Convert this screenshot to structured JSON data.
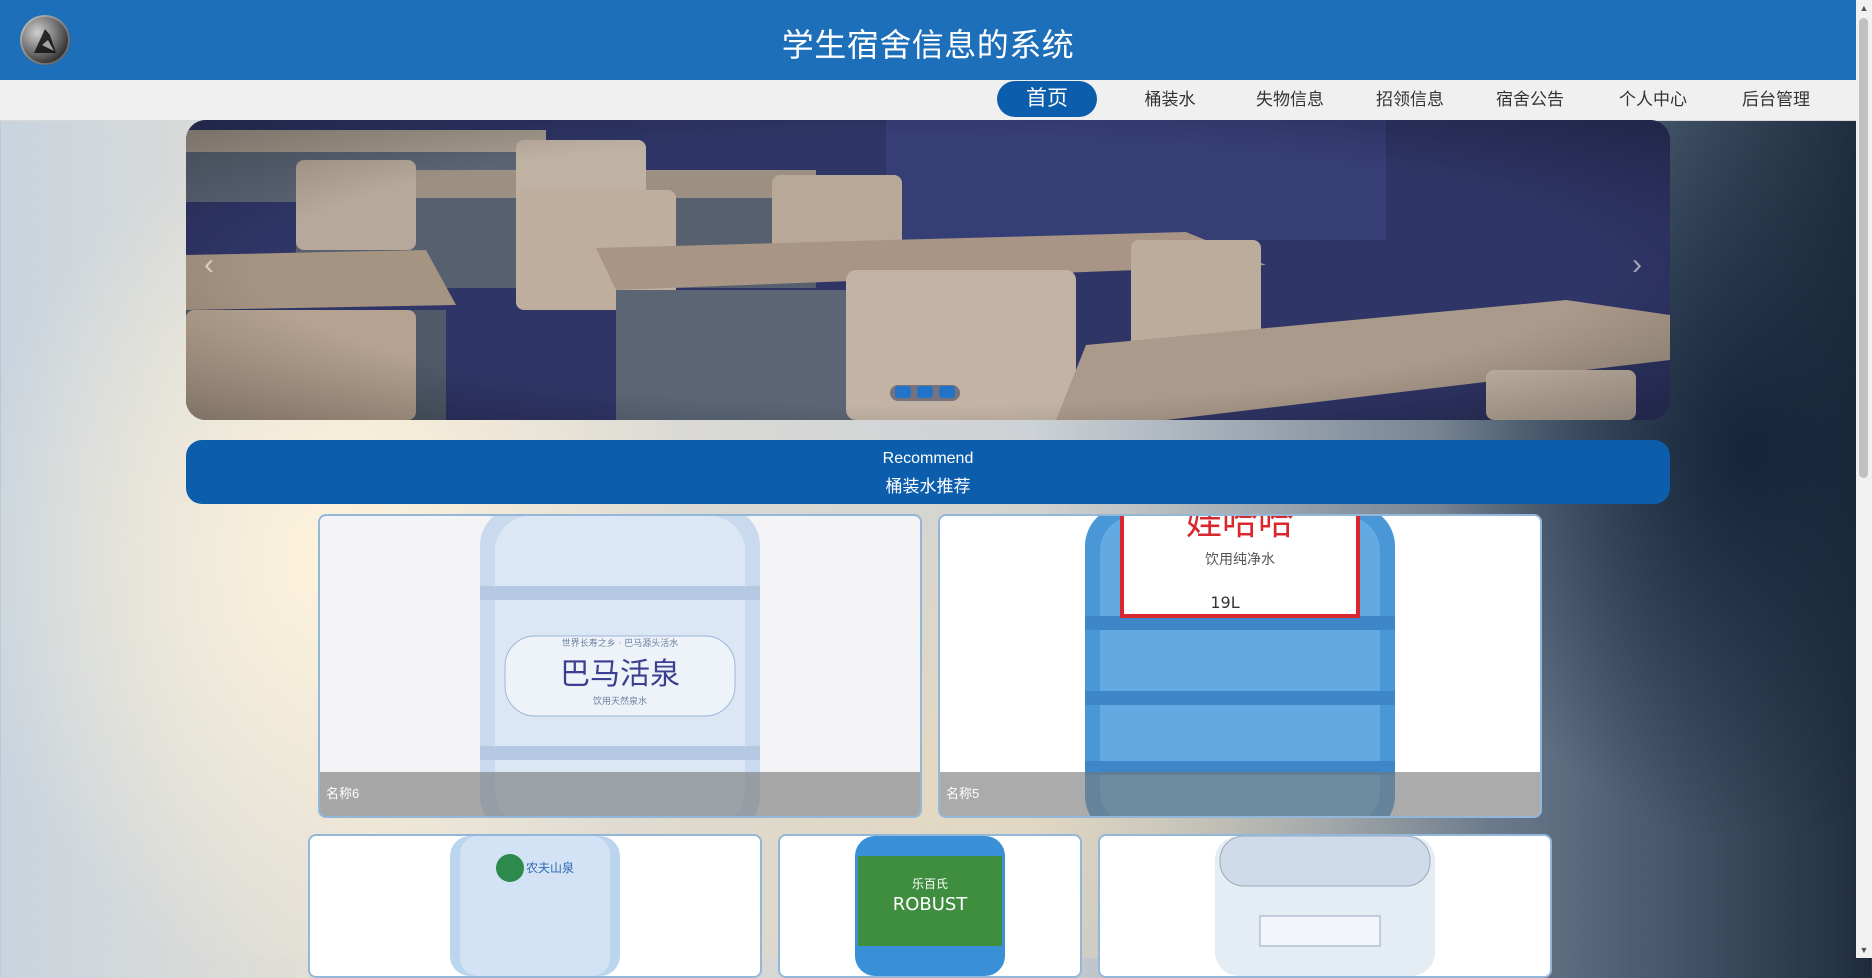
{
  "header": {
    "title": "学生宿舍信息的系统",
    "logo_icon": "avatar-logo-icon"
  },
  "nav": {
    "items": [
      {
        "label": "首页",
        "active": true
      },
      {
        "label": "桶装水",
        "active": false
      },
      {
        "label": "失物信息",
        "active": false
      },
      {
        "label": "招领信息",
        "active": false
      },
      {
        "label": "宿舍公告",
        "active": false
      },
      {
        "label": "个人中心",
        "active": false
      },
      {
        "label": "后台管理",
        "active": false
      }
    ]
  },
  "banner": {
    "slide_count": 3,
    "active_slide": 1,
    "prev_icon": "chevron-left-icon",
    "next_icon": "chevron-right-icon"
  },
  "recommend": {
    "title_en": "Recommend",
    "title_cn": "桶装水推荐"
  },
  "products": [
    {
      "name": "名称6"
    },
    {
      "name": "名称5"
    },
    {
      "name": ""
    },
    {
      "name": ""
    },
    {
      "name": ""
    }
  ],
  "colors": {
    "primary": "#1e6fba",
    "accent": "#0c5ead",
    "nav_bg": "#f0f0f0"
  }
}
